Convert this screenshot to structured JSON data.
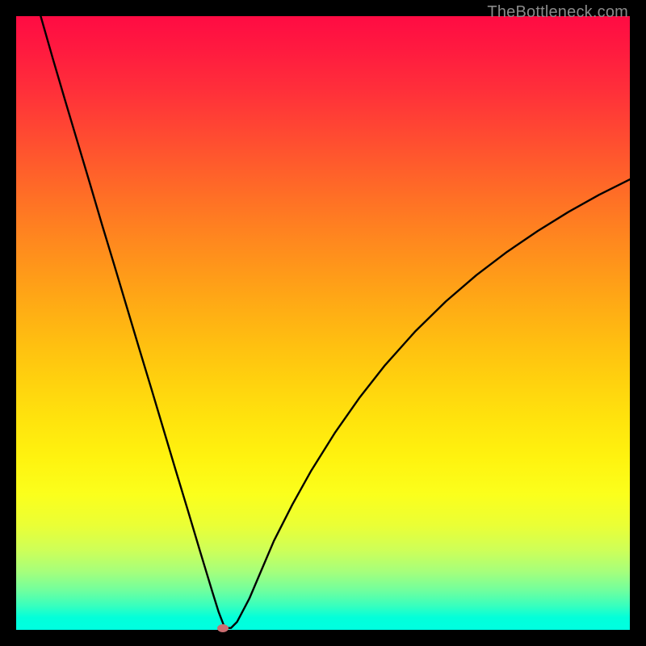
{
  "watermark": "TheBottleneck.com",
  "chart_data": {
    "type": "line",
    "title": "",
    "xlabel": "",
    "ylabel": "",
    "xlim": [
      0,
      100
    ],
    "ylim": [
      0,
      100
    ],
    "grid": false,
    "legend": false,
    "series": [
      {
        "name": "bottleneck-curve",
        "x": [
          4,
          6,
          8,
          10,
          12,
          14,
          16,
          18,
          20,
          22,
          24,
          26,
          28,
          30,
          31,
          32,
          33,
          34,
          35,
          36,
          38,
          40,
          42,
          45,
          48,
          52,
          56,
          60,
          65,
          70,
          75,
          80,
          85,
          90,
          95,
          100
        ],
        "y": [
          100,
          93,
          86.2,
          79.5,
          72.8,
          66,
          59.4,
          52.7,
          46,
          39.4,
          32.7,
          26,
          19.4,
          12.7,
          9.4,
          6.1,
          2.9,
          0.3,
          0.3,
          1.3,
          5.1,
          9.8,
          14.5,
          20.4,
          25.8,
          32.2,
          37.9,
          43,
          48.6,
          53.5,
          57.8,
          61.6,
          65,
          68.1,
          70.9,
          73.4
        ]
      }
    ],
    "marker": {
      "x": 33.7,
      "y": 0.2,
      "color": "#cb6e71"
    },
    "gradient_stops": [
      {
        "pct": 0,
        "color": "#ff0b43"
      },
      {
        "pct": 50,
        "color": "#ffae14"
      },
      {
        "pct": 78,
        "color": "#fbff1c"
      },
      {
        "pct": 100,
        "color": "#00ffe1"
      }
    ],
    "line_color": "#000000",
    "line_width": 2.4
  }
}
